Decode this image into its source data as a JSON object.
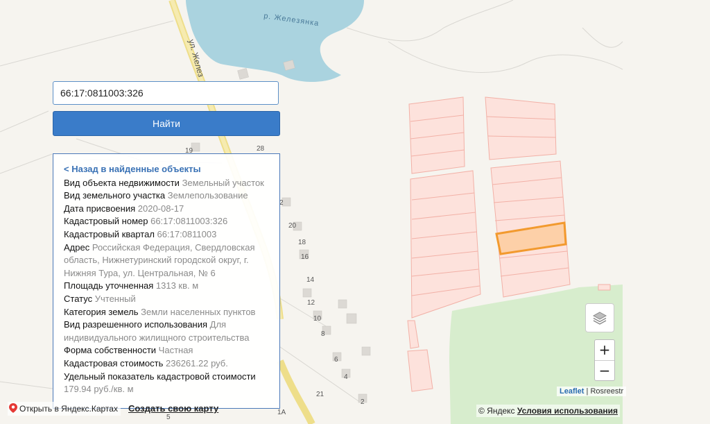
{
  "map": {
    "river_label": "р. Железянка",
    "street_label": "ул. Желез",
    "house_numbers": [
      "19",
      "28",
      "2",
      "20",
      "18",
      "16",
      "14",
      "12",
      "10",
      "8",
      "6",
      "4",
      "2",
      "5",
      "1А",
      "21"
    ],
    "colors": {
      "water": "#aad3df",
      "green": "#d4ecc9",
      "parcel_fill": "#fde2dc",
      "parcel_stroke": "#f0aaa0",
      "selected_fill": "#fdd0a8",
      "selected_stroke": "#f29a2e",
      "road": "#f3e27a"
    }
  },
  "search": {
    "value": "66:17:0811003:326"
  },
  "find_button": {
    "label": "Найти"
  },
  "info": {
    "back_link": "< Назад в найденные объекты",
    "rows": [
      {
        "label": "Вид объекта недвижимости",
        "value": "Земельный участок"
      },
      {
        "label": "Вид земельного участка",
        "value": "Землепользование"
      },
      {
        "label": "Дата присвоения",
        "value": "2020-08-17"
      },
      {
        "label": "Кадастровый номер",
        "value": "66:17:0811003:326"
      },
      {
        "label": "Кадастровый квартал",
        "value": "66:17:0811003"
      },
      {
        "label": "Адрес",
        "value": "Российская Федерация, Свердловская область, Нижнетуринский городской округ, г. Нижняя Тура, ул. Центральная, № 6"
      },
      {
        "label": "Площадь уточненная",
        "value": "1313 кв. м"
      },
      {
        "label": "Статус",
        "value": "Учтенный"
      },
      {
        "label": "Категория земель",
        "value": "Земли населенных пунктов"
      },
      {
        "label": "Вид разрешенного использования",
        "value": "Для индивидуального жилищного строительства"
      },
      {
        "label": "Форма собственности",
        "value": "Частная"
      },
      {
        "label": "Кадастровая стоимость",
        "value": "236261.22 руб."
      },
      {
        "label": "Удельный показатель кадастровой стоимости",
        "value": "179.94 руб./кв. м"
      }
    ]
  },
  "zoom": {
    "in": "+",
    "out": "−"
  },
  "attribution": {
    "leaflet": "Leaflet",
    "separator": " | ",
    "source": "Rosreestr"
  },
  "footer": {
    "copyright": "© Яндекс",
    "terms": "Условия использования",
    "open_in_yandex": "Открыть в Яндекс.Картах",
    "create_map": "Создать свою карту"
  },
  "icons": {
    "layers": "layers-icon",
    "pin": "map-pin-icon"
  }
}
